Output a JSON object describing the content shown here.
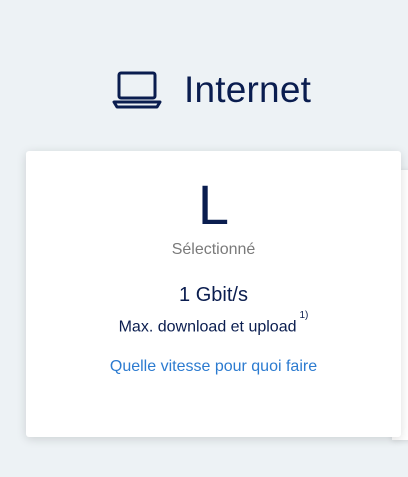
{
  "header": {
    "icon": "laptop-icon",
    "title": "Internet"
  },
  "plan": {
    "letter": "L",
    "status": "Sélectionné",
    "speed": "1 Gbit/s",
    "speed_description": "Max. download et upload",
    "footnote": "1)",
    "link_label": "Quelle vitesse pour quoi faire"
  },
  "colors": {
    "background": "#edf2f5",
    "primary_text": "#0a1d4f",
    "muted_text": "#7a7a7a",
    "link": "#2c7bd0",
    "card": "#ffffff"
  }
}
